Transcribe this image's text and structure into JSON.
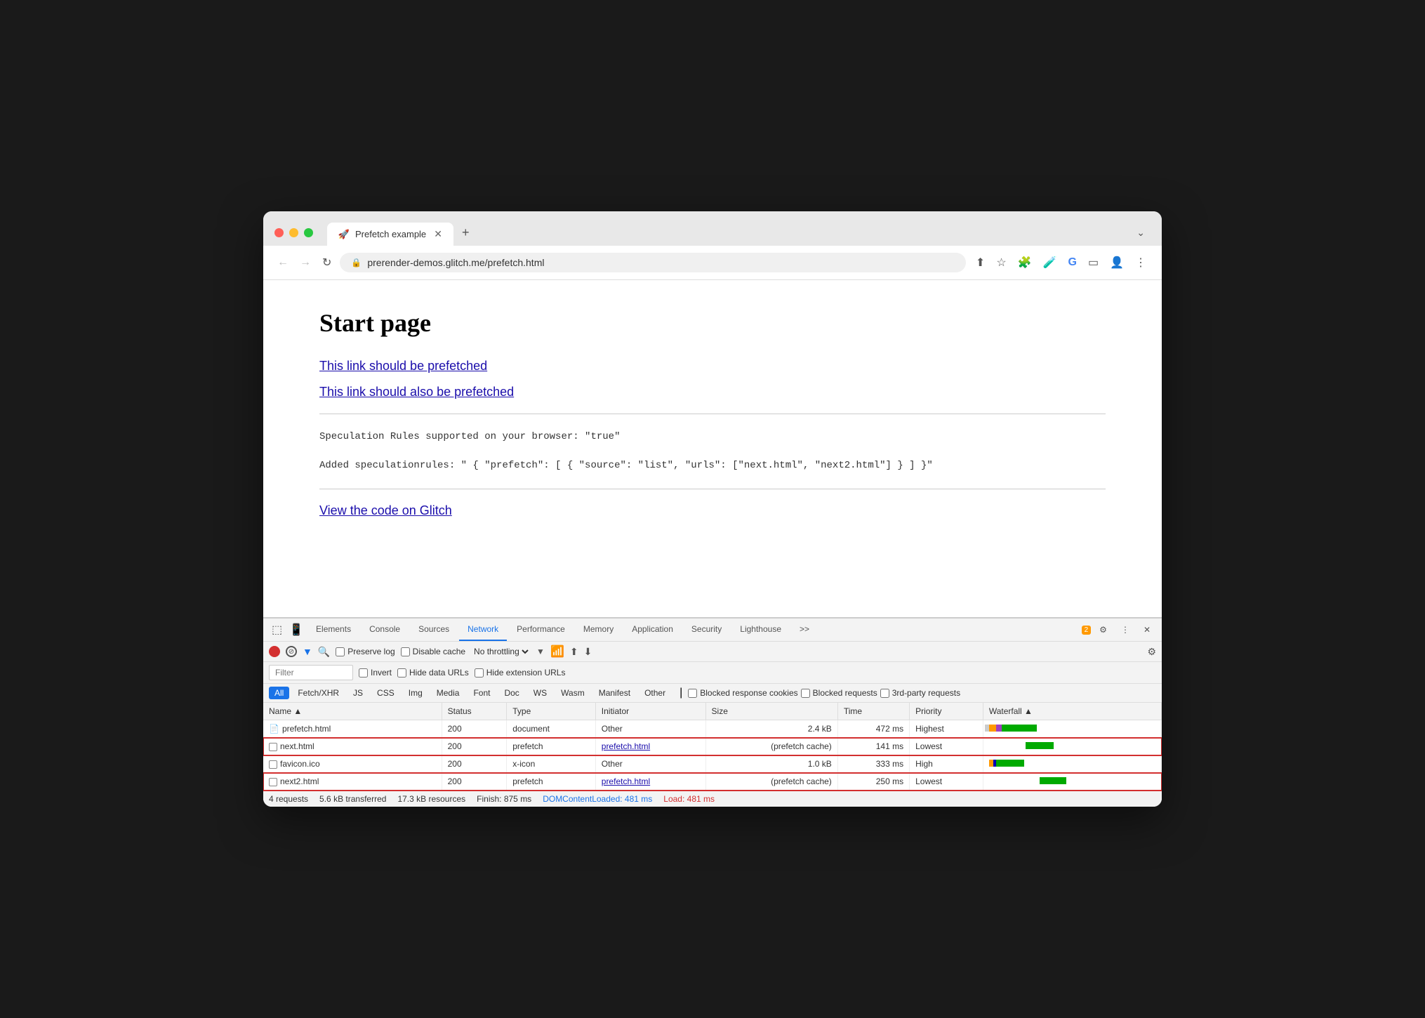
{
  "browser": {
    "tab_title": "Prefetch example",
    "tab_favicon": "🚀",
    "url": "prerender-demos.glitch.me/prefetch.html",
    "new_tab_label": "+",
    "menu_label": "⌄"
  },
  "page": {
    "title": "Start page",
    "link1": "This link should be prefetched",
    "link2": "This link should also be prefetched",
    "spec_line1": "Speculation Rules supported on your browser: \"true\"",
    "spec_line2": "Added speculationrules: \" { \"prefetch\": [ { \"source\": \"list\", \"urls\": [\"next.html\", \"next2.html\"] } ] }\"",
    "glitch_link": "View the code on Glitch"
  },
  "devtools": {
    "tabs": [
      "Elements",
      "Console",
      "Sources",
      "Network",
      "Performance",
      "Memory",
      "Application",
      "Security",
      "Lighthouse",
      ">>"
    ],
    "active_tab": "Network",
    "badge": "2",
    "settings_icon": "⚙",
    "more_icon": "⋮",
    "close_icon": "✕"
  },
  "network_toolbar": {
    "preserve_log": "Preserve log",
    "disable_cache": "Disable cache",
    "throttle": "No throttling"
  },
  "filter_bar": {
    "placeholder": "Filter",
    "invert": "Invert",
    "hide_data_urls": "Hide data URLs",
    "hide_extension_urls": "Hide extension URLs"
  },
  "type_filters": [
    "All",
    "Fetch/XHR",
    "JS",
    "CSS",
    "Img",
    "Media",
    "Font",
    "Doc",
    "WS",
    "Wasm",
    "Manifest",
    "Other"
  ],
  "blocked_filters": [
    "Blocked response cookies",
    "Blocked requests",
    "3rd-party requests"
  ],
  "table": {
    "headers": [
      "Name",
      "Status",
      "Type",
      "Initiator",
      "Size",
      "Time",
      "Priority",
      "Waterfall"
    ],
    "rows": [
      {
        "name": "prefetch.html",
        "status": "200",
        "type": "document",
        "initiator": "Other",
        "size": "2.4 kB",
        "time": "472 ms",
        "priority": "Highest",
        "icon": "doc",
        "highlighted": false
      },
      {
        "name": "next.html",
        "status": "200",
        "type": "prefetch",
        "initiator": "prefetch.html",
        "size": "(prefetch cache)",
        "time": "141 ms",
        "priority": "Lowest",
        "icon": "checkbox",
        "highlighted": true
      },
      {
        "name": "favicon.ico",
        "status": "200",
        "type": "x-icon",
        "initiator": "Other",
        "size": "1.0 kB",
        "time": "333 ms",
        "priority": "High",
        "icon": "checkbox",
        "highlighted": false
      },
      {
        "name": "next2.html",
        "status": "200",
        "type": "prefetch",
        "initiator": "prefetch.html",
        "size": "(prefetch cache)",
        "time": "250 ms",
        "priority": "Lowest",
        "icon": "checkbox",
        "highlighted": true
      }
    ]
  },
  "status_bar": {
    "requests": "4 requests",
    "transferred": "5.6 kB transferred",
    "resources": "17.3 kB resources",
    "finish": "Finish: 875 ms",
    "dom_loaded": "DOMContentLoaded: 481 ms",
    "load": "Load: 481 ms"
  }
}
